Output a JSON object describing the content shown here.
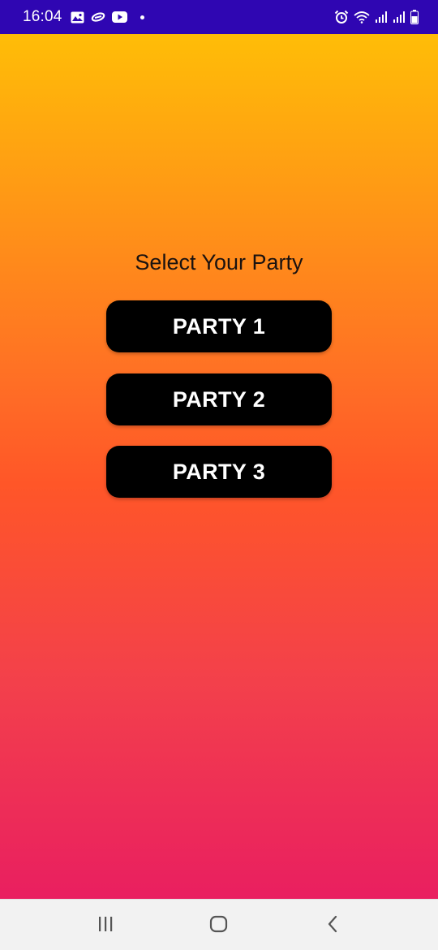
{
  "status_bar": {
    "time": "16:04",
    "left_icons": [
      "gallery-icon",
      "link-icon",
      "youtube-icon",
      "notification-dot-icon"
    ],
    "right_icons": [
      "alarm-icon",
      "wifi-icon",
      "signal-icon",
      "signal-icon",
      "battery-icon"
    ],
    "background_color": "#2f06b2"
  },
  "main": {
    "title": "Select Your Party",
    "buttons": [
      {
        "label": "PARTY 1"
      },
      {
        "label": "PARTY 2"
      },
      {
        "label": "PARTY 3"
      }
    ],
    "gradient_colors": [
      "#ffbd07",
      "#ff5628",
      "#e91f60"
    ]
  },
  "nav_bar": {
    "buttons": [
      "recents-icon",
      "home-icon",
      "back-icon"
    ]
  }
}
